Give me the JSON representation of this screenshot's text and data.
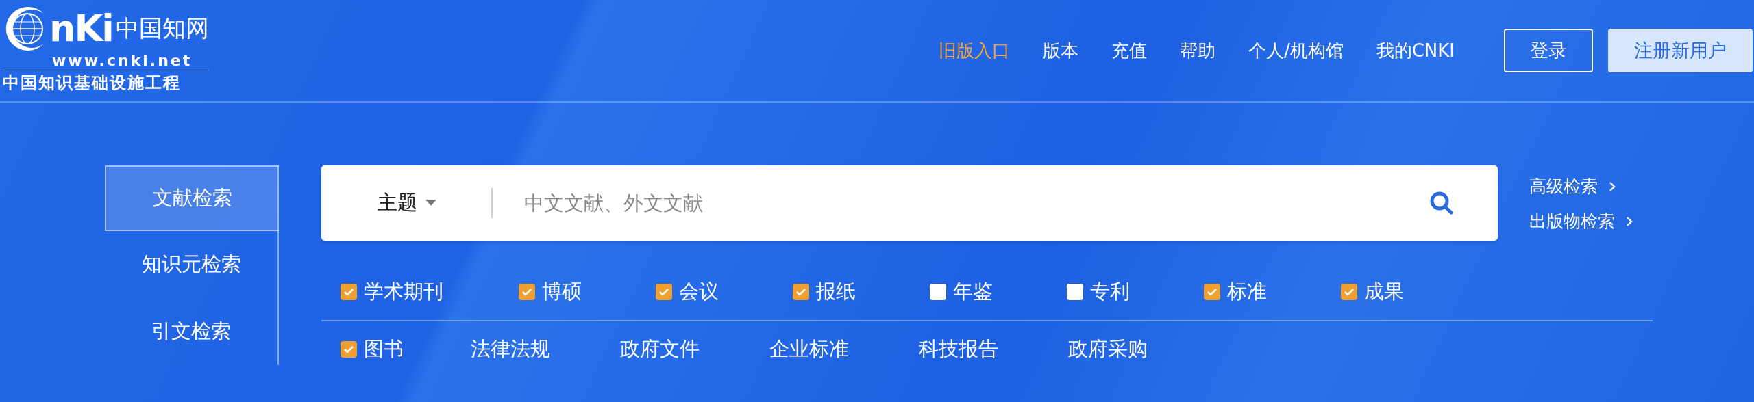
{
  "logo": {
    "mark": "nKi",
    "name": "中国知网",
    "url": "www.cnki.net",
    "slogan": "中国知识基础设施工程"
  },
  "nav": [
    {
      "label": "旧版入口",
      "highlighted": true
    },
    {
      "label": "版本",
      "highlighted": false
    },
    {
      "label": "充值",
      "highlighted": false
    },
    {
      "label": "帮助",
      "highlighted": false
    },
    {
      "label": "个人/机构馆",
      "highlighted": false
    },
    {
      "label": "我的CNKI",
      "highlighted": false
    }
  ],
  "account_buttons": [
    {
      "label": "登录",
      "kind": "outline"
    },
    {
      "label": "注册新用户",
      "kind": "filled"
    }
  ],
  "search_tabs": [
    {
      "label": "文献检索",
      "selected": true
    },
    {
      "label": "知识元检索",
      "selected": false
    },
    {
      "label": "引文检索",
      "selected": false
    }
  ],
  "search": {
    "field": "主题",
    "placeholder": "中文文献、外文文献"
  },
  "side_links": [
    "高级检索",
    "出版物检索"
  ],
  "sources_row_1": [
    {
      "kind": "checkbox",
      "label": "学术期刊",
      "checked": true
    },
    {
      "kind": "checkbox",
      "label": "博硕",
      "checked": true
    },
    {
      "kind": "checkbox",
      "label": "会议",
      "checked": true
    },
    {
      "kind": "checkbox",
      "label": "报纸",
      "checked": true
    },
    {
      "kind": "checkbox",
      "label": "年鉴",
      "checked": false
    },
    {
      "kind": "checkbox",
      "label": "专利",
      "checked": false
    },
    {
      "kind": "checkbox",
      "label": "标准",
      "checked": true
    },
    {
      "kind": "checkbox",
      "label": "成果",
      "checked": true
    }
  ],
  "sources_row_2": [
    {
      "kind": "checkbox",
      "label": "图书",
      "checked": true
    },
    {
      "kind": "link",
      "label": "法律法规"
    },
    {
      "kind": "link",
      "label": "政府文件"
    },
    {
      "kind": "link",
      "label": "企业标准"
    },
    {
      "kind": "link",
      "label": "科技报告"
    },
    {
      "kind": "link",
      "label": "政府采购"
    }
  ]
}
